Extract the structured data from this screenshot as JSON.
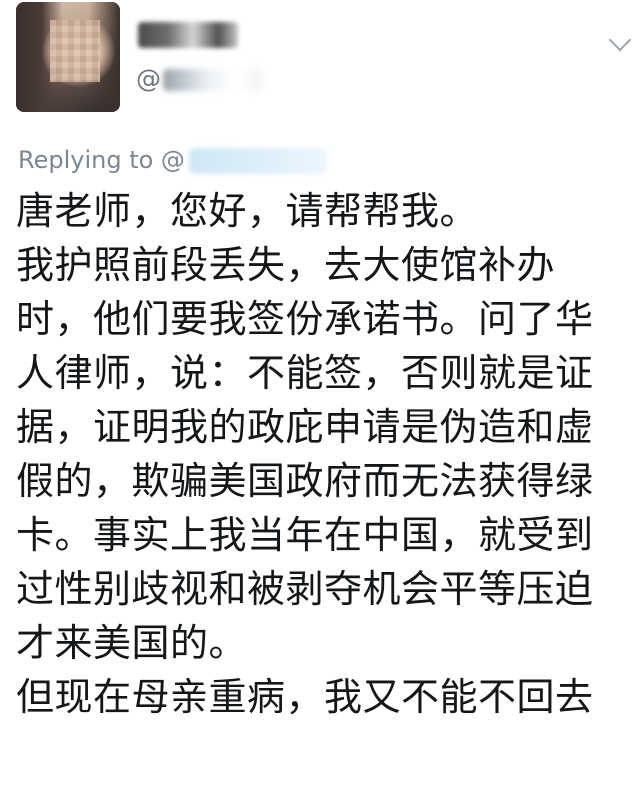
{
  "profile": {
    "handle_prefix": "@",
    "avatar_icon": "user-avatar-icon",
    "name_redacted": true
  },
  "reply": {
    "label": "Replying to @"
  },
  "tweet": {
    "lines": [
      "唐老师，您好，请帮帮我。",
      "我护照前段丢失，去大使馆补办",
      "时，他们要我签份承诺书。问了华",
      "人律师，说：不能签，否则就是证",
      "据，证明我的政庇申请是伪造和虚",
      "假的，欺骗美国政府而无法获得绿",
      "卡。事实上我当年在中国，就受到",
      "过性别歧视和被剥夺机会平等压迫",
      "才来美国的。",
      "但现在母亲重病，我又不能不回去"
    ]
  },
  "colors": {
    "text": "#14171a",
    "secondary": "#7a8794",
    "background": "#ffffff"
  }
}
